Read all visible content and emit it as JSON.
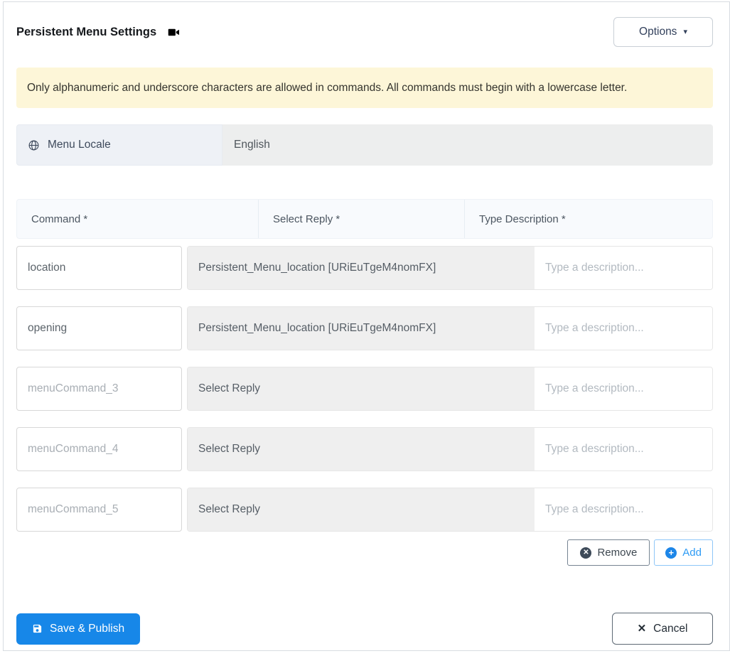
{
  "header": {
    "title": "Persistent Menu Settings",
    "options_label": "Options"
  },
  "banner": {
    "text": "Only alphanumeric and underscore characters are allowed in commands. All commands must begin with a lowercase letter."
  },
  "locale": {
    "label": "Menu Locale",
    "value": "English"
  },
  "table": {
    "headers": [
      "Command *",
      "Select Reply *",
      "Type Description *"
    ],
    "rows": [
      {
        "command_value": "location",
        "reply": "Persistent_Menu_location [URiEuTgeM4nomFX]",
        "description_placeholder": "Type a description..."
      },
      {
        "command_value": "opening",
        "reply": "Persistent_Menu_location [URiEuTgeM4nomFX]",
        "description_placeholder": "Type a description..."
      },
      {
        "command_placeholder": "menuCommand_3",
        "reply": "Select Reply",
        "description_placeholder": "Type a description..."
      },
      {
        "command_placeholder": "menuCommand_4",
        "reply": "Select Reply",
        "description_placeholder": "Type a description..."
      },
      {
        "command_placeholder": "menuCommand_5",
        "reply": "Select Reply",
        "description_placeholder": "Type a description..."
      }
    ]
  },
  "actions": {
    "remove_label": "Remove",
    "add_label": "Add"
  },
  "footer": {
    "save_label": "Save & Publish",
    "cancel_label": "Cancel"
  },
  "icons": {
    "caret_down": "▾",
    "remove_glyph": "✕",
    "add_glyph": "+",
    "cancel_glyph": "✕"
  },
  "colors": {
    "primary_blue": "#1787e8",
    "add_blue": "#2d9bf5",
    "banner_bg": "#fdf6d8",
    "table_header_bg": "#f8fafd",
    "select_bg": "#efefef",
    "locale_label_bg": "#eef1f6",
    "disabled_field_bg": "#edeeee",
    "dark_icon_bg": "#3d4a59"
  }
}
